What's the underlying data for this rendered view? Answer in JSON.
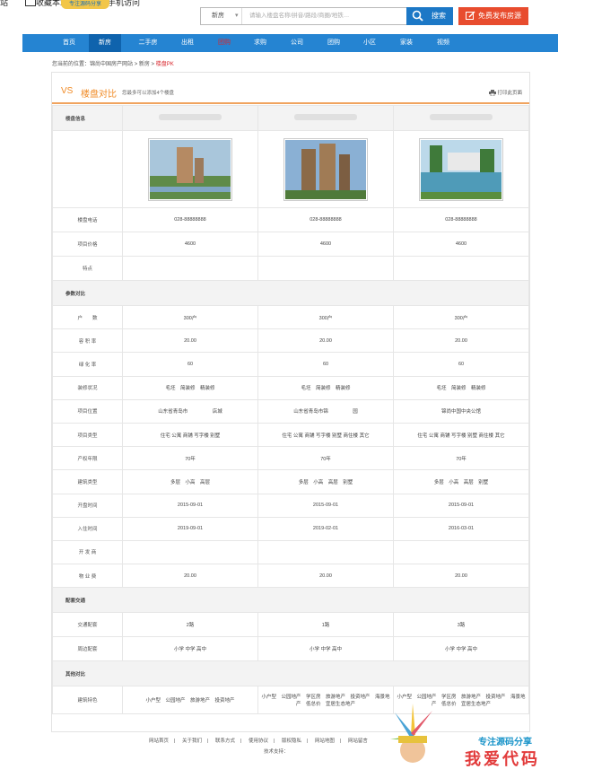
{
  "top": {
    "fragment_text": "站",
    "fragment_text2": "收藏本站",
    "fragment_text3": "手机访问",
    "logo_text": "专注源码分享"
  },
  "search": {
    "select_value": "新房",
    "placeholder": "请输入楼盘名称/拼音/路段/商圈/地铁…",
    "button": "搜索",
    "post_button": "免费发布房源"
  },
  "nav": [
    "首页",
    "新房",
    "二手房",
    "出租",
    "团购",
    "求购",
    "公司",
    "团购",
    "小区",
    "家装",
    "视频"
  ],
  "breadcrumb": {
    "prefix": "您当前的位置：",
    "site": "锦尚中国房产网站",
    "sep1": " > ",
    "section": "新房",
    "sep2": " > ",
    "current": "楼盘PK"
  },
  "header": {
    "vs": "VS",
    "title": "楼盘对比",
    "subtitle": "您最多可以添加4个楼盘",
    "print": "打印此页面"
  },
  "sections": {
    "info": "楼盘信息",
    "params": "参数对比",
    "traffic": "配套交通",
    "other": "其他对比"
  },
  "rows": [
    {
      "label": "楼盘电话",
      "values": [
        "028-88888888",
        "028-88888888",
        "028-88888888"
      ]
    },
    {
      "label": "项目价格",
      "values": [
        "4600",
        "4600",
        "4600"
      ]
    },
    {
      "label": "特点",
      "values": [
        "",
        "",
        ""
      ]
    }
  ],
  "param_rows": [
    {
      "label": "户　　数",
      "values": [
        "300户",
        "300户",
        "300户"
      ]
    },
    {
      "label": "容 积 率",
      "values": [
        "20.00",
        "20.00",
        "20.00"
      ]
    },
    {
      "label": "绿 化 率",
      "values": [
        "60",
        "60",
        "60"
      ]
    },
    {
      "label": "装修状况",
      "values": [
        "毛坯　简装修　精装修",
        "毛坯　简装修　精装修",
        "毛坯　简装修　精装修"
      ]
    },
    {
      "label": "项目位置",
      "values": [
        "山东省青岛市　　　　　店城",
        "山东省青岛市锦　　　　　园",
        "锦尚中国中央公馆"
      ]
    },
    {
      "label": "项目类型",
      "values": [
        "住宅 公寓 商铺 写字楼 别墅",
        "住宅 公寓 商铺 写字楼 别墅 商住楼 其它",
        "住宅 公寓 商铺 写字楼 别墅 商住楼 其它"
      ]
    },
    {
      "label": "产权年限",
      "values": [
        "70年",
        "70年",
        "70年"
      ]
    },
    {
      "label": "建筑类型",
      "values": [
        "多层　小高　高层",
        "多层　小高　高层　别墅",
        "多层　小高　高层　别墅"
      ]
    },
    {
      "label": "开盘时间",
      "values": [
        "2015-09-01",
        "2015-09-01",
        "2015-09-01"
      ]
    },
    {
      "label": "入住时间",
      "values": [
        "2019-09-01",
        "2019-02-01",
        "2016-03-01"
      ]
    },
    {
      "label": "开 发 商",
      "values": [
        "",
        "",
        ""
      ]
    },
    {
      "label": "物 业 费",
      "values": [
        "20.00",
        "20.00",
        "20.00"
      ]
    }
  ],
  "traffic_rows": [
    {
      "label": "交通配套",
      "values": [
        "2路",
        "1路",
        "3路"
      ]
    },
    {
      "label": "周边配套",
      "values": [
        "小学 中学 高中",
        "小学 中学 高中",
        "小学 中学 高中"
      ]
    }
  ],
  "other_rows": [
    {
      "label": "建筑特色",
      "values": [
        "小户型　公园地产　旅游地产　投资地产",
        "小户型　公园地产　学区房　旅游地产　投资地产　海景地产　低总价　宜居生态地产",
        "小户型　公园地产　学区房　旅游地产　投资地产　海景地产　低总价　宜居生态地产"
      ]
    }
  ],
  "footer": {
    "links": [
      "网站首页",
      "关于我们",
      "联系方式",
      "使用协议",
      "版权隐私",
      "网站地图",
      "网站留言"
    ],
    "tech": "技术支持："
  },
  "watermark": {
    "line1": "专注源码分享",
    "line2": "我爱代码"
  },
  "colors": {
    "nav": "#2584d2",
    "nav_active": "#0f63ad",
    "accent": "#f08a24",
    "search_btn": "#1c78c6",
    "post_btn": "#e84c2e"
  }
}
